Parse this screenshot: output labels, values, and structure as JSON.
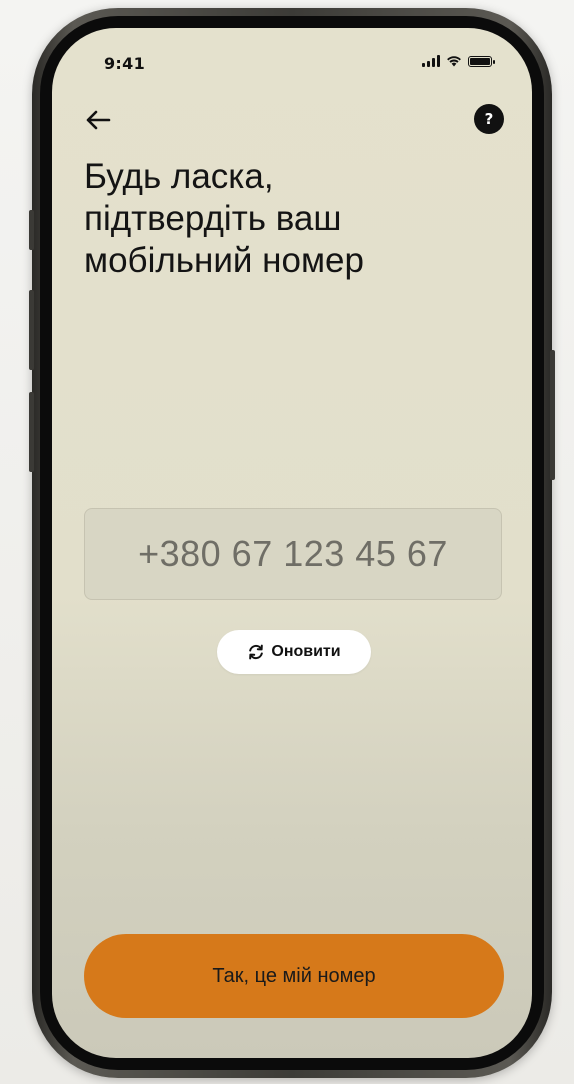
{
  "status_bar": {
    "time": "9:41",
    "icons": [
      "signal-icon",
      "wifi-icon",
      "battery-icon"
    ]
  },
  "nav": {
    "back_icon": "arrow-left-icon",
    "help_label": "?"
  },
  "title": {
    "line1": "Будь ласка,",
    "line2": "підтвердіть ваш",
    "line3": "мобільний номер"
  },
  "phone_field": {
    "value": "+380 67 123 45 67"
  },
  "refresh_button": {
    "label": "Оновити",
    "icon": "refresh-icon"
  },
  "confirm_button": {
    "label": "Так, це мій номер"
  },
  "colors": {
    "accent": "#d6791a",
    "background": "#e4e1cd",
    "text": "#141414"
  }
}
